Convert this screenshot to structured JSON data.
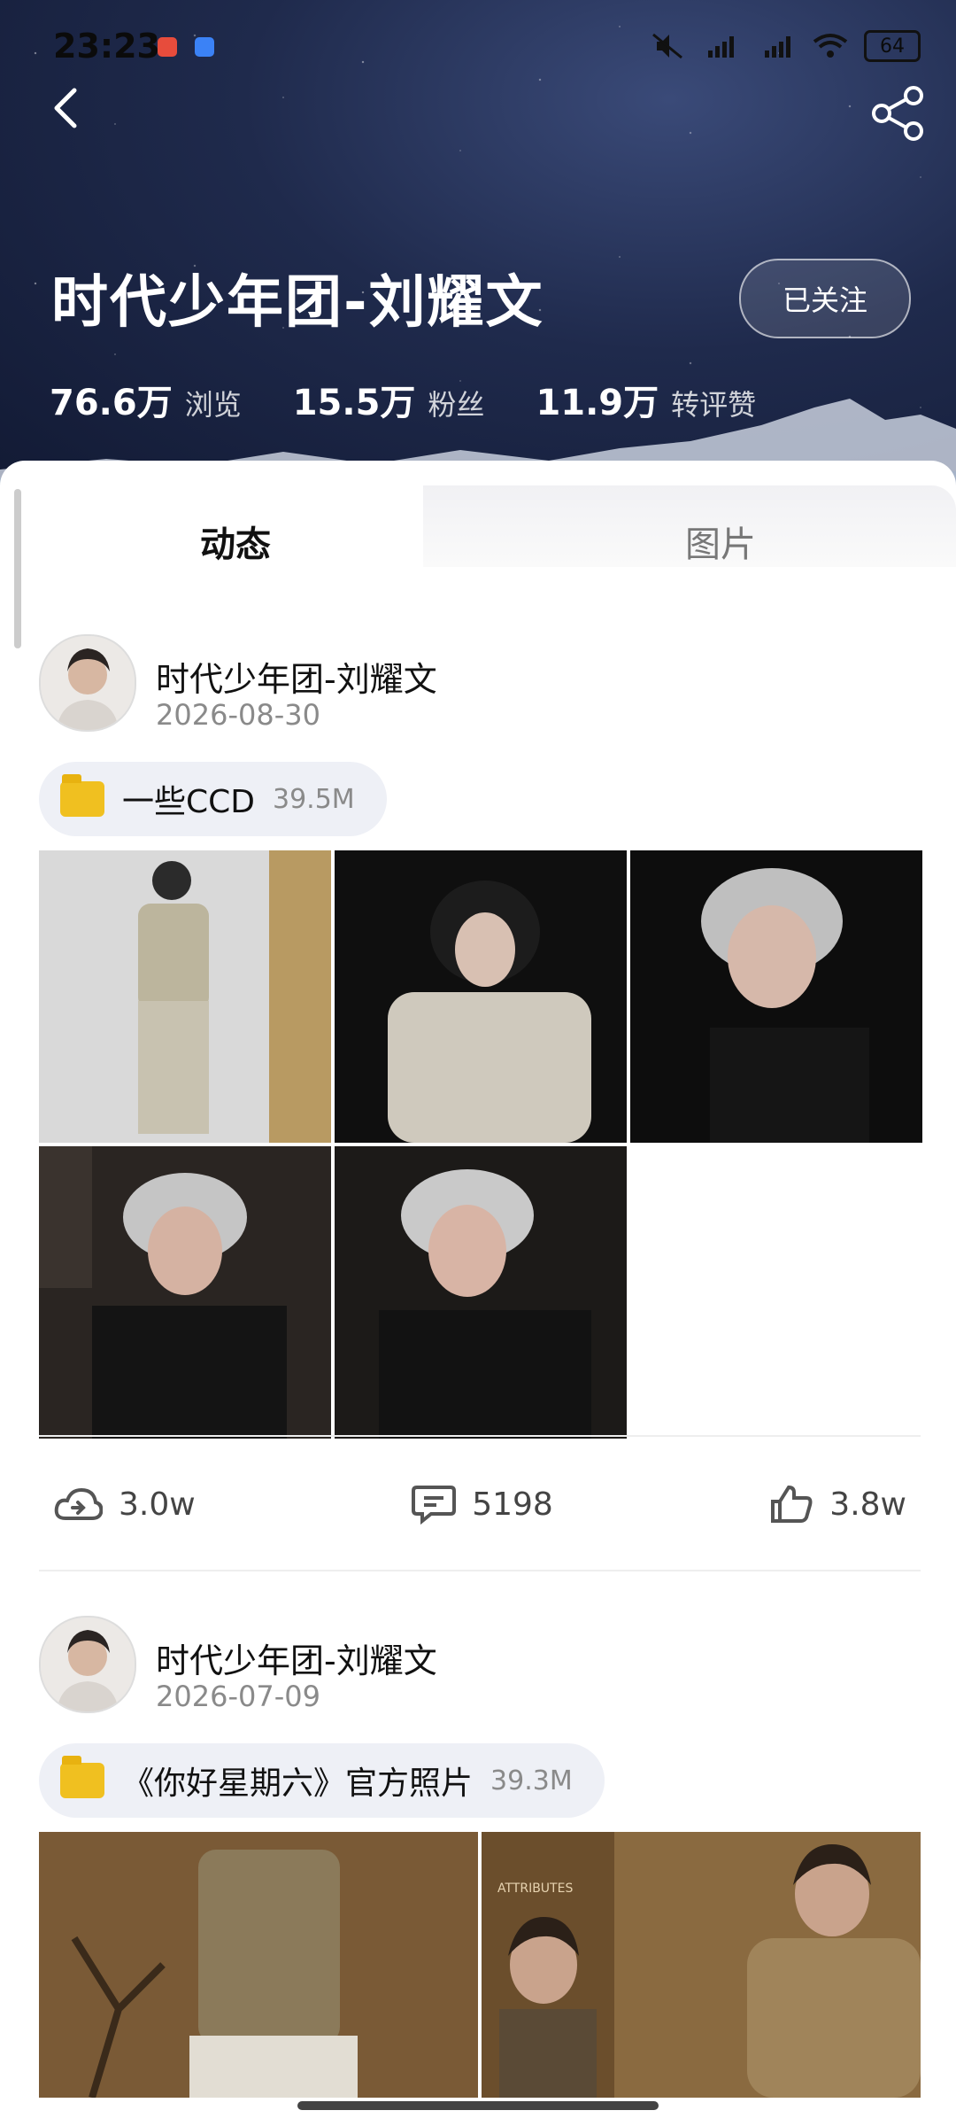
{
  "status_bar": {
    "time": "23:23",
    "battery": "64"
  },
  "header": {
    "title": "时代少年团-刘耀文",
    "follow_label": "已关注",
    "stats": [
      {
        "value": "76.6万",
        "label": "浏览"
      },
      {
        "value": "15.5万",
        "label": "粉丝"
      },
      {
        "value": "11.9万",
        "label": "转评赞"
      }
    ]
  },
  "tabs": [
    {
      "label": "动态",
      "active": true
    },
    {
      "label": "图片",
      "active": false
    }
  ],
  "posts": [
    {
      "author": "时代少年团-刘耀文",
      "date": "2026-08-30",
      "folder": {
        "name": "一些CCD",
        "size": "39.5M"
      },
      "images_count": 5,
      "actions": {
        "repost": "3.0w",
        "comments": "5198",
        "likes": "3.8w"
      }
    },
    {
      "author": "时代少年团-刘耀文",
      "date": "2026-07-09",
      "folder": {
        "name": "《你好星期六》官方照片",
        "size": "39.3M"
      },
      "images_count": 2,
      "image_text": "ATTRIBUTES"
    }
  ],
  "colors": {
    "header_bg": "#1f2a4c",
    "folder": "#f0c020",
    "chip_bg": "#eef0f6"
  }
}
